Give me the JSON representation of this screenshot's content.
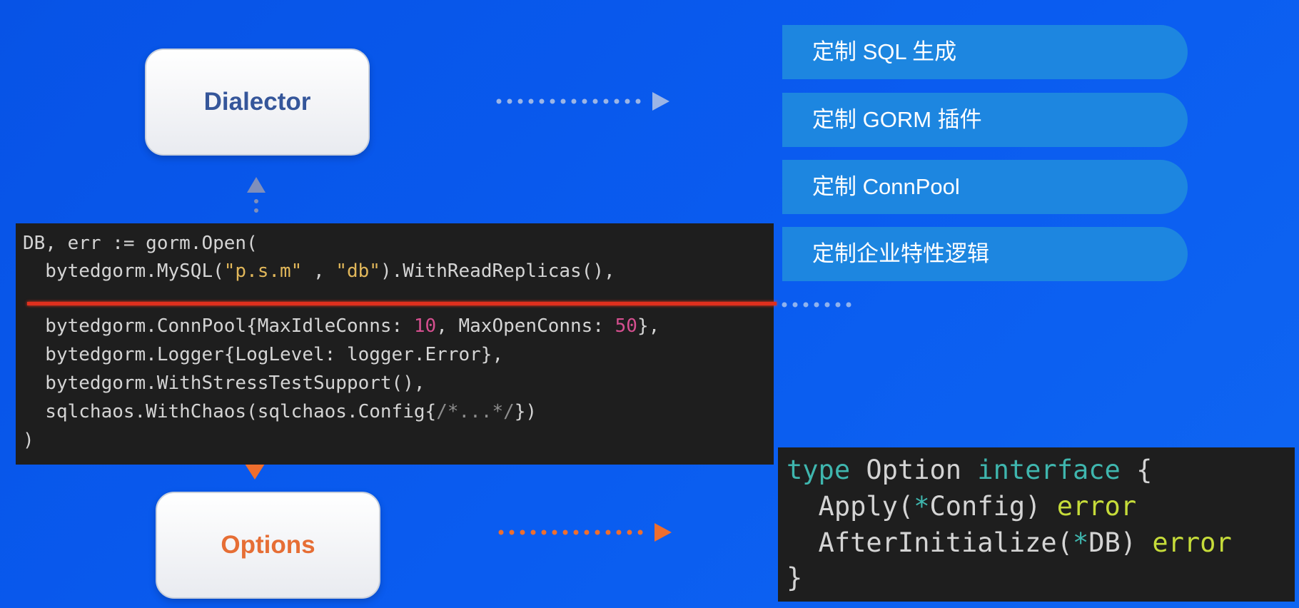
{
  "cards": {
    "dialector": "Dialector",
    "options": "Options"
  },
  "features": [
    "定制 SQL 生成",
    "定制 GORM 插件",
    "定制 ConnPool",
    "定制企业特性逻辑"
  ],
  "code_main": {
    "l1a": "DB, err := gorm.Open(",
    "l2a": "  bytedgorm.MySQL(",
    "l2b": "\"p.s.m\"",
    "l2c": " , ",
    "l2d": "\"db\"",
    "l2e": ").WithReadReplicas(),",
    "l3a": "  bytedgorm.ConnPool{MaxIdleConns: ",
    "l3b": "10",
    "l3c": ", MaxOpenConns: ",
    "l3d": "50",
    "l3e": "},",
    "l4a": "  bytedgorm.Logger{LogLevel: logger.Error},",
    "l5a": "  bytedgorm.WithStressTestSupport(),",
    "l6a": "  sqlchaos.WithChaos(sqlchaos.Config{",
    "l6b": "/*...*/",
    "l6c": "})",
    "l7a": ")"
  },
  "code_iface": {
    "l1a": "type",
    "l1b": " Option ",
    "l1c": "interface",
    "l1d": " {",
    "l2a": "  Apply(",
    "l2b": "*",
    "l2c": "Config) ",
    "l2d": "error",
    "l3a": "  AfterInitialize(",
    "l3b": "*",
    "l3c": "DB) ",
    "l3d": "error",
    "l4a": "}"
  },
  "colors": {
    "background": "#0753e6",
    "pill": "#1d86e0",
    "dialector_text": "#35569a",
    "options_text": "#e66e35",
    "arrow_dialector": "#9bb5e6",
    "arrow_options": "#ee6e2e",
    "code_bg": "#1e1e1e"
  },
  "icons": [
    "dotted-arrow-right-icon",
    "dotted-arrow-up-icon",
    "dotted-arrow-down-icon"
  ]
}
